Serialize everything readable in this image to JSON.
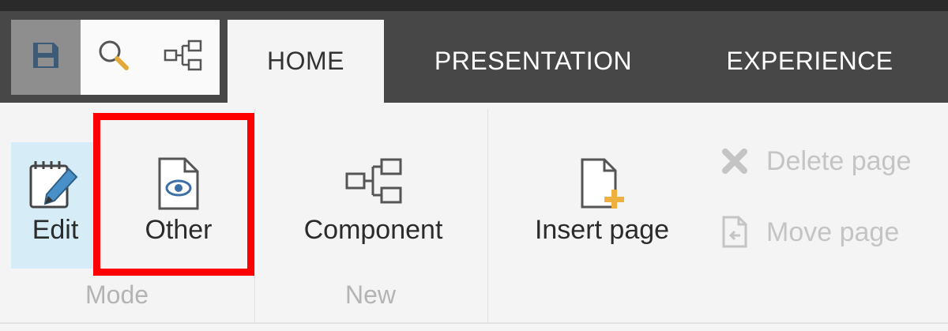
{
  "quick_access": {
    "save_icon": "save-icon",
    "search_icon": "search-icon",
    "tree_icon": "hierarchy-icon"
  },
  "tabs": [
    {
      "label": "HOME",
      "active": true
    },
    {
      "label": "PRESENTATION",
      "active": false
    },
    {
      "label": "EXPERIENCE",
      "active": false
    }
  ],
  "ribbon": {
    "mode_group": {
      "label": "Mode",
      "edit_label": "Edit",
      "other_label": "Other"
    },
    "new_group": {
      "label": "New",
      "component_label": "Component"
    },
    "page_group": {
      "insert_label": "Insert page",
      "delete_label": "Delete page",
      "move_label": "Move page"
    }
  },
  "colors": {
    "tabbar": "#474747",
    "highlight": "#ff0000",
    "edit_active_bg": "#d6ecf7",
    "insert_accent": "#f0b040"
  }
}
